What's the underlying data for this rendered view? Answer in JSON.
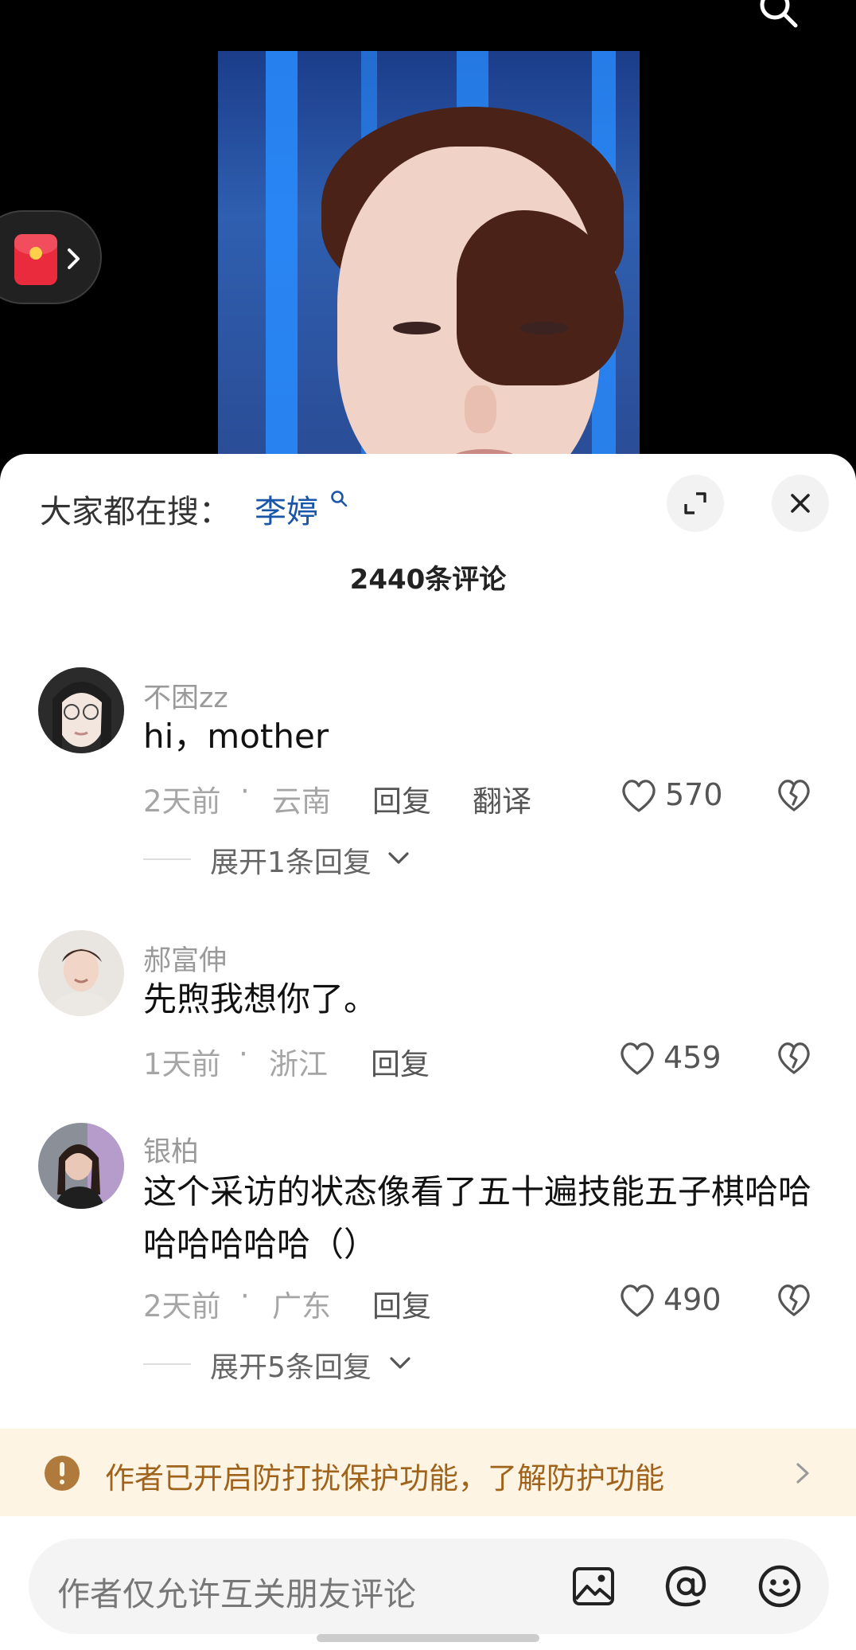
{
  "header": {
    "search_icon": "search-icon"
  },
  "video": {
    "description_icon": "video-frame"
  },
  "promo": {
    "icon": "red-packet-icon"
  },
  "sheet": {
    "trending_label": "大家都在搜：",
    "trending_term": "李婷",
    "comment_count": "2440条评论"
  },
  "comments": [
    {
      "username": "不困zz",
      "text": "hi，mother",
      "time": "2天前",
      "location": "云南",
      "reply_label": "回复",
      "translate_label": "翻译",
      "likes": "570",
      "expand_label": "展开1条回复"
    },
    {
      "username": "郝富伸",
      "text": "先煦我想你了。",
      "time": "1天前",
      "location": "浙江",
      "reply_label": "回复",
      "likes": "459"
    },
    {
      "username": "银柏",
      "text": "这个采访的状态像看了五十遍技能五子棋哈哈哈哈哈哈哈（）",
      "time": "2天前",
      "location": "广东",
      "reply_label": "回复",
      "likes": "490",
      "expand_label": "展开5条回复"
    }
  ],
  "notice": {
    "text": "作者已开启防打扰保护功能，了解防护功能"
  },
  "composer": {
    "placeholder": "作者仅允许互关朋友评论"
  },
  "colors": {
    "link_blue": "#1a56a8",
    "notice_bg": "#fdf4e3",
    "notice_text": "#a0631c",
    "red_packet": "#ea2a3d"
  }
}
